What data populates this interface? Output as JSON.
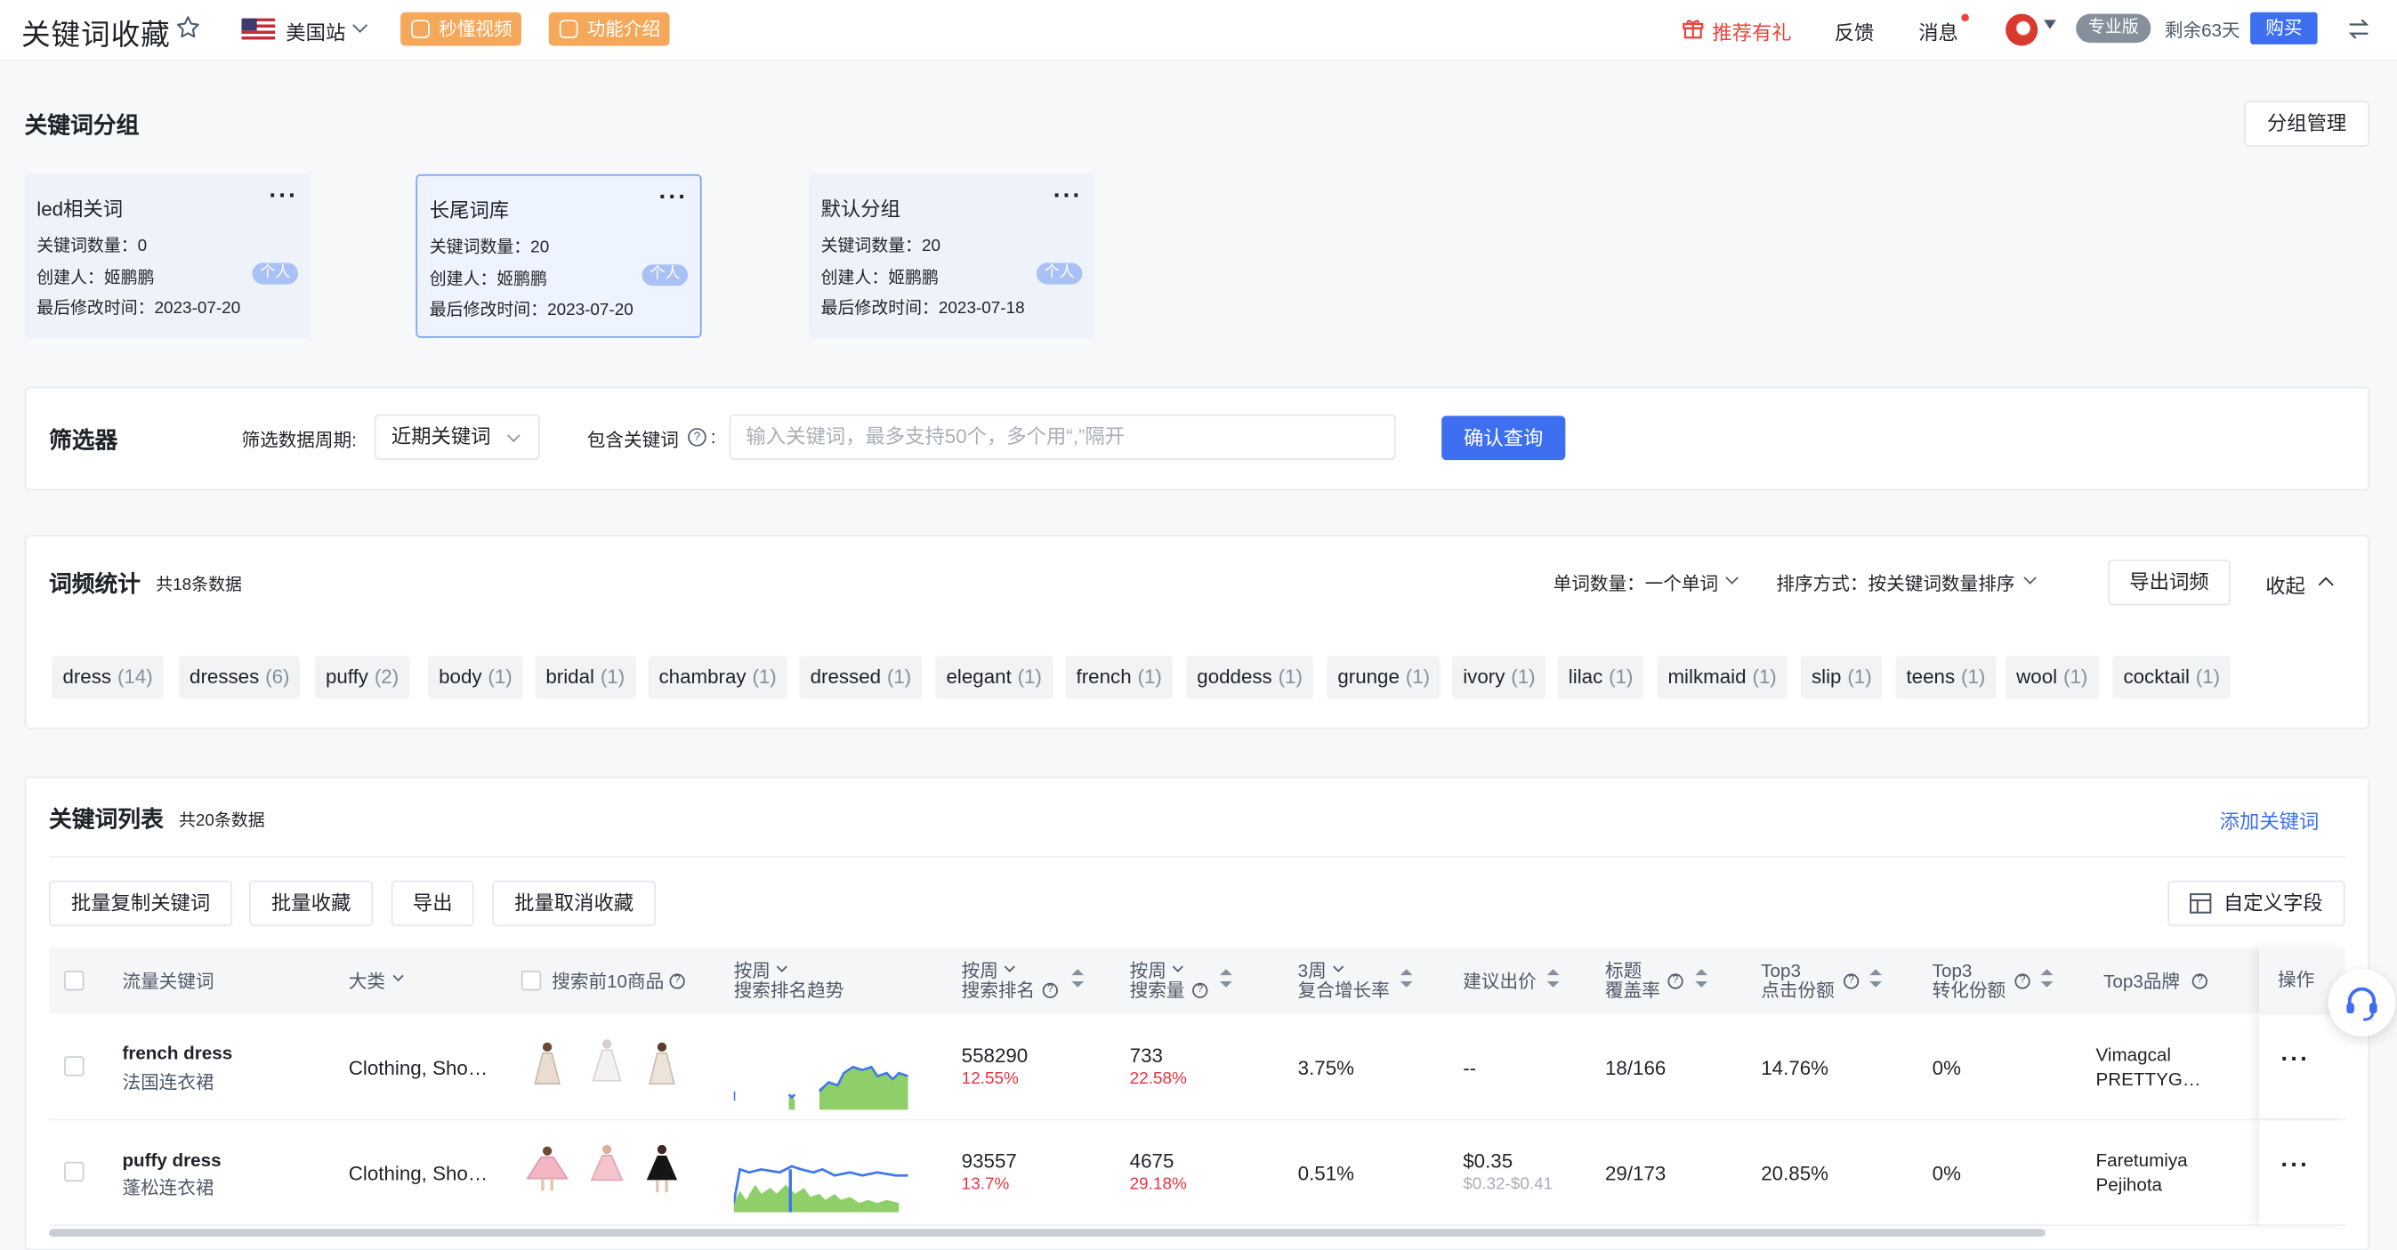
{
  "header": {
    "title": "关键词收藏",
    "site": "美国站",
    "video_btn": "秒懂视频",
    "intro_btn": "功能介绍",
    "gift": "推荐有礼",
    "feedback": "反馈",
    "messages": "消息",
    "plan": "专业版",
    "remaining": "剩余63天",
    "buy": "购买"
  },
  "groups": {
    "title": "关键词分组",
    "manage_btn": "分组管理",
    "cards": [
      {
        "name": "led相关词",
        "count": "关键词数量：0",
        "creator": "创建人：姬鹏鹏",
        "tag": "个人",
        "modified": "最后修改时间：2023-07-20"
      },
      {
        "name": "长尾词库",
        "count": "关键词数量：20",
        "creator": "创建人：姬鹏鹏",
        "tag": "个人",
        "modified": "最后修改时间：2023-07-20"
      },
      {
        "name": "默认分组",
        "count": "关键词数量：20",
        "creator": "创建人：姬鹏鹏",
        "tag": "个人",
        "modified": "最后修改时间：2023-07-18"
      }
    ]
  },
  "filter": {
    "title": "筛选器",
    "period_label": "筛选数据周期:",
    "period_value": "近期关键词",
    "include_label": "包含关键词",
    "include_placeholder": "输入关键词，最多支持50个，多个用“,”隔开",
    "confirm": "确认查询"
  },
  "freq": {
    "title": "词频统计",
    "total": "共18条数据",
    "word_count_label": "单词数量：",
    "word_count_value": "一个单词",
    "sort_label": "排序方式：",
    "sort_value": "按关键词数量排序",
    "export": "导出词频",
    "collapse": "收起",
    "chips": [
      {
        "word": "dress",
        "count": "(14)"
      },
      {
        "word": "dresses",
        "count": "(6)"
      },
      {
        "word": "puffy",
        "count": "(2)"
      },
      {
        "word": "body",
        "count": "(1)"
      },
      {
        "word": "bridal",
        "count": "(1)"
      },
      {
        "word": "chambray",
        "count": "(1)"
      },
      {
        "word": "dressed",
        "count": "(1)"
      },
      {
        "word": "elegant",
        "count": "(1)"
      },
      {
        "word": "french",
        "count": "(1)"
      },
      {
        "word": "goddess",
        "count": "(1)"
      },
      {
        "word": "grunge",
        "count": "(1)"
      },
      {
        "word": "ivory",
        "count": "(1)"
      },
      {
        "word": "lilac",
        "count": "(1)"
      },
      {
        "word": "milkmaid",
        "count": "(1)"
      },
      {
        "word": "slip",
        "count": "(1)"
      },
      {
        "word": "teens",
        "count": "(1)"
      },
      {
        "word": "wool",
        "count": "(1)"
      },
      {
        "word": "cocktail",
        "count": "(1)"
      }
    ]
  },
  "list": {
    "title": "关键词列表",
    "total": "共20条数据",
    "add": "添加关键词",
    "batch_copy": "批量复制关键词",
    "batch_fav": "批量收藏",
    "export": "导出",
    "batch_unfav": "批量取消收藏",
    "custom_fields": "自定义字段",
    "columns": {
      "keyword": "流量关键词",
      "category": "大类",
      "top10": "搜索前10商品",
      "trend_1": "按周",
      "trend_2": "搜索排名趋势",
      "rank_1": "按周",
      "rank_2": "搜索排名",
      "volume_1": "按周",
      "volume_2": "搜索量",
      "growth_1": "3周",
      "growth_2": "复合增长率",
      "bid": "建议出价",
      "title_cov_1": "标题",
      "title_cov_2": "覆盖率",
      "click_1": "Top3",
      "click_2": "点击份额",
      "conv_1": "Top3",
      "conv_2": "转化份额",
      "brand": "Top3品牌",
      "ops": "操作"
    },
    "rows": [
      {
        "keyword": "french dress",
        "keyword_cn": "法国连衣裙",
        "category": "Clothing, Sho…",
        "rank": "558290",
        "rank_pct": "12.55%",
        "volume": "733",
        "volume_pct": "22.58%",
        "growth": "3.75%",
        "bid": "--",
        "bid_range": "",
        "title_cov": "18/166",
        "click_share": "14.76%",
        "conv_share": "0%",
        "brand_1": "Vimagcal",
        "brand_2": "PRETTYG…"
      },
      {
        "keyword": "puffy dress",
        "keyword_cn": "蓬松连衣裙",
        "category": "Clothing, Sho…",
        "rank": "93557",
        "rank_pct": "13.7%",
        "volume": "4675",
        "volume_pct": "29.18%",
        "growth": "0.51%",
        "bid": "$0.35",
        "bid_range": "$0.32-$0.41",
        "title_cov": "29/173",
        "click_share": "20.85%",
        "conv_share": "0%",
        "brand_1": "Faretumiya",
        "brand_2": "Pejihota"
      }
    ]
  },
  "colors": {
    "primary": "#3d6ff0",
    "orange": "#f5a85a",
    "red": "#e8333d",
    "trend_green": "#8fcf6a",
    "trend_blue": "#3f78e8"
  }
}
